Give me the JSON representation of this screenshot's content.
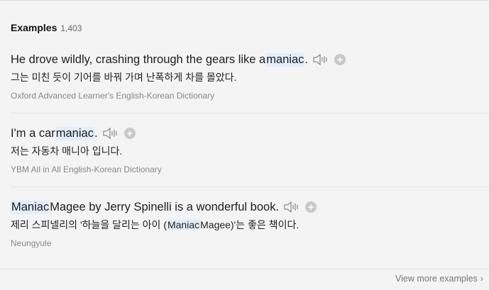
{
  "header": {
    "title": "Examples",
    "count": "1,403"
  },
  "examples": [
    {
      "en_before": "He drove wildly, crashing through the gears like a ",
      "en_highlight": "maniac",
      "en_after": ".",
      "ko": "그는 미친 듯이 기어를 바꿔 가며 난폭하게 차를 몰았다.",
      "source": "Oxford Advanced Learner's English-Korean Dictionary"
    },
    {
      "en_before": "I'm a car ",
      "en_highlight": "maniac",
      "en_after": ".",
      "ko": "저는 자동차 매니아 입니다.",
      "source": "YBM All in All English-Korean Dictionary"
    },
    {
      "en_before": "",
      "en_highlight": "Maniac",
      "en_after": " Magee by Jerry Spinelli is a wonderful book.",
      "ko_before": "제리 스피넬리의 '하늘을 달리는 아이 (",
      "ko_highlight": "Maniac",
      "ko_after": " Magee)'는 좋은 책이다.",
      "source": "Neungyule"
    }
  ],
  "footer": {
    "more_label": "View more examples",
    "chevron": "›"
  },
  "colors": {
    "highlight": "#e3eefb",
    "background": "#f4f4f5",
    "icon": "#8a8a8a"
  }
}
